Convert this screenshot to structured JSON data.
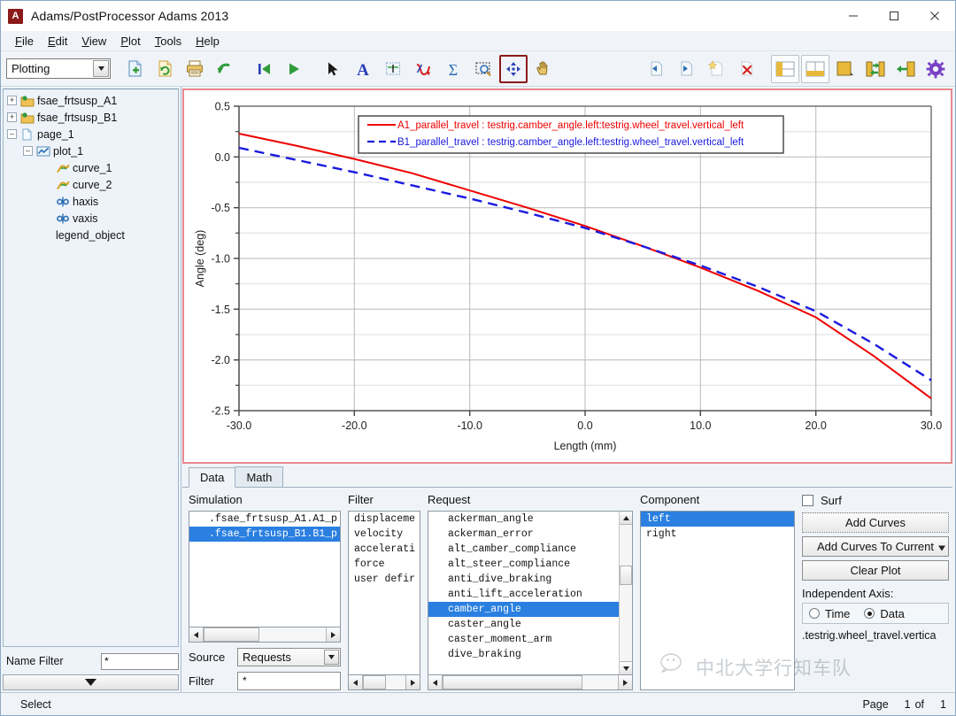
{
  "window": {
    "title": "Adams/PostProcessor Adams 2013",
    "logo_letter": "A",
    "minimize_label": "Minimize",
    "maximize_label": "Maximize",
    "close_label": "Close"
  },
  "menubar": {
    "items": [
      {
        "label": "File",
        "accel": "F"
      },
      {
        "label": "Edit",
        "accel": "E"
      },
      {
        "label": "View",
        "accel": "V"
      },
      {
        "label": "Plot",
        "accel": "P"
      },
      {
        "label": "Tools",
        "accel": "T"
      },
      {
        "label": "Help",
        "accel": "H"
      }
    ]
  },
  "toolbar": {
    "mode_combo_value": "Plotting",
    "buttons": [
      {
        "name": "new-page-icon",
        "title": "New Page"
      },
      {
        "name": "reload-icon",
        "title": "Reload"
      },
      {
        "name": "print-icon",
        "title": "Print"
      },
      {
        "name": "undo-icon",
        "title": "Undo"
      },
      {
        "name": "first-frame-icon",
        "title": "First Frame"
      },
      {
        "name": "play-icon",
        "title": "Play"
      },
      {
        "name": "select-arrow-icon",
        "title": "Select"
      },
      {
        "name": "text-tool-icon",
        "title": "Text"
      },
      {
        "name": "axis-tool-icon",
        "title": "Axis"
      },
      {
        "name": "curve-tool-icon",
        "title": "Curve"
      },
      {
        "name": "sigma-tool-icon",
        "title": "Statistics"
      },
      {
        "name": "zoom-region-icon",
        "title": "Zoom Region"
      },
      {
        "name": "pan-move-icon",
        "title": "Pan"
      },
      {
        "name": "hand-tool-icon",
        "title": "Hand"
      },
      {
        "name": "page-prev-icon",
        "title": "Previous Page"
      },
      {
        "name": "page-next-icon",
        "title": "Next Page"
      },
      {
        "name": "page-add-icon",
        "title": "Add Page"
      },
      {
        "name": "page-delete-icon",
        "title": "Delete Page"
      },
      {
        "name": "layout-left-icon",
        "title": "Layout Left"
      },
      {
        "name": "layout-bottom-icon",
        "title": "Layout Bottom"
      },
      {
        "name": "layout-full-icon",
        "title": "Layout Full"
      },
      {
        "name": "swap-icon",
        "title": "Swap"
      },
      {
        "name": "collapse-icon",
        "title": "Collapse"
      },
      {
        "name": "settings-gear-icon",
        "title": "Settings"
      }
    ]
  },
  "tree": {
    "nodes": [
      {
        "label": "fsae_frtsusp_A1",
        "indent": 1,
        "expander": "+",
        "icon": "model-folder-icon"
      },
      {
        "label": "fsae_frtsusp_B1",
        "indent": 1,
        "expander": "+",
        "icon": "model-folder-icon"
      },
      {
        "label": "page_1",
        "indent": 1,
        "expander": "-",
        "icon": "page-icon"
      },
      {
        "label": "plot_1",
        "indent": 2,
        "expander": "-",
        "icon": "plot-icon"
      },
      {
        "label": "curve_1",
        "indent": 3,
        "expander": "",
        "icon": "curve-icon"
      },
      {
        "label": "curve_2",
        "indent": 3,
        "expander": "",
        "icon": "curve-icon"
      },
      {
        "label": "haxis",
        "indent": 3,
        "expander": "",
        "icon": "axis-icon"
      },
      {
        "label": "vaxis",
        "indent": 3,
        "expander": "",
        "icon": "axis-icon"
      },
      {
        "label": "legend_object",
        "indent": 3,
        "expander": "",
        "icon": "none"
      }
    ],
    "name_filter_label": "Name Filter",
    "name_filter_value": "*"
  },
  "chart_data": {
    "type": "line",
    "title": "",
    "xlabel": "Length (mm)",
    "ylabel": "Angle (deg)",
    "xlim": [
      -30.0,
      30.0
    ],
    "ylim": [
      -2.5,
      0.5
    ],
    "xticks": [
      "-30.0",
      "-20.0",
      "-10.0",
      "0.0",
      "10.0",
      "20.0",
      "30.0"
    ],
    "xtick_values": [
      -30,
      -20,
      -10,
      0,
      10,
      20,
      30
    ],
    "yticks": [
      "0.5",
      "0.0",
      "-0.5",
      "-1.0",
      "-1.5",
      "-2.0",
      "-2.5"
    ],
    "ytick_values": [
      0.5,
      0.0,
      -0.5,
      -1.0,
      -1.5,
      -2.0,
      -2.5
    ],
    "grid": true,
    "legend_position": "top-center",
    "series": [
      {
        "name": "A1_parallel_travel : testrig.camber_angle.left:testrig.wheel_travel.vertical_left",
        "color": "#ee0000",
        "style": "solid",
        "x": [
          -30,
          -25,
          -20,
          -15,
          -10,
          -5,
          0,
          5,
          10,
          15,
          20,
          25,
          30
        ],
        "values": [
          0.23,
          0.11,
          -0.02,
          -0.16,
          -0.33,
          -0.5,
          -0.68,
          -0.88,
          -1.09,
          -1.32,
          -1.58,
          -1.96,
          -2.38
        ]
      },
      {
        "name": "B1_parallel_travel : testrig.camber_angle.left:testrig.wheel_travel.vertical_left",
        "color": "#1a1ae0",
        "style": "dashed",
        "x": [
          -30,
          -25,
          -20,
          -15,
          -10,
          -5,
          0,
          5,
          10,
          15,
          20,
          25,
          30
        ],
        "values": [
          0.09,
          -0.03,
          -0.15,
          -0.28,
          -0.41,
          -0.55,
          -0.7,
          -0.88,
          -1.07,
          -1.28,
          -1.52,
          -1.84,
          -2.2
        ]
      }
    ]
  },
  "bottom": {
    "tabs": [
      {
        "label": "Data",
        "selected": true
      },
      {
        "label": "Math",
        "selected": false
      }
    ],
    "simulation": {
      "label": "Simulation",
      "items": [
        {
          "text": ".fsae_frtsusp_A1.A1_p",
          "selected": false
        },
        {
          "text": ".fsae_frtsusp_B1.B1_p",
          "selected": true
        }
      ],
      "source_label": "Source",
      "source_value": "Requests",
      "filter_label": "Filter",
      "filter_value": "*"
    },
    "filter": {
      "label": "Filter",
      "items": [
        {
          "text": "displaceme",
          "selected": false
        },
        {
          "text": "velocity",
          "selected": false
        },
        {
          "text": "accelerati",
          "selected": false
        },
        {
          "text": "force",
          "selected": false
        },
        {
          "text": "user defir",
          "selected": false
        }
      ]
    },
    "request": {
      "label": "Request",
      "items": [
        {
          "text": "ackerman_angle",
          "selected": false
        },
        {
          "text": "ackerman_error",
          "selected": false
        },
        {
          "text": "alt_camber_compliance",
          "selected": false
        },
        {
          "text": "alt_steer_compliance",
          "selected": false
        },
        {
          "text": "anti_dive_braking",
          "selected": false
        },
        {
          "text": "anti_lift_acceleration",
          "selected": false
        },
        {
          "text": "camber_angle",
          "selected": true
        },
        {
          "text": "caster_angle",
          "selected": false
        },
        {
          "text": "caster_moment_arm",
          "selected": false
        },
        {
          "text": "dive_braking",
          "selected": false
        }
      ]
    },
    "component": {
      "label": "Component",
      "items": [
        {
          "text": "left",
          "selected": true
        },
        {
          "text": "right",
          "selected": false
        }
      ]
    },
    "actions": {
      "surf_label": "Surf",
      "surf_checked": false,
      "add_curves_label": "Add Curves",
      "add_curves_to_current_label": "Add Curves To Current",
      "clear_plot_label": "Clear Plot",
      "independent_axis_label": "Independent Axis:",
      "time_label": "Time",
      "data_label": "Data",
      "axis_selected": "Data",
      "axis_path": ".testrig.wheel_travel.vertica"
    }
  },
  "statusbar": {
    "message": "Select",
    "page_label": "Page",
    "page_current": "1",
    "page_of": "of",
    "page_total": "1"
  },
  "watermark": {
    "text": "中北大学行知车队"
  }
}
